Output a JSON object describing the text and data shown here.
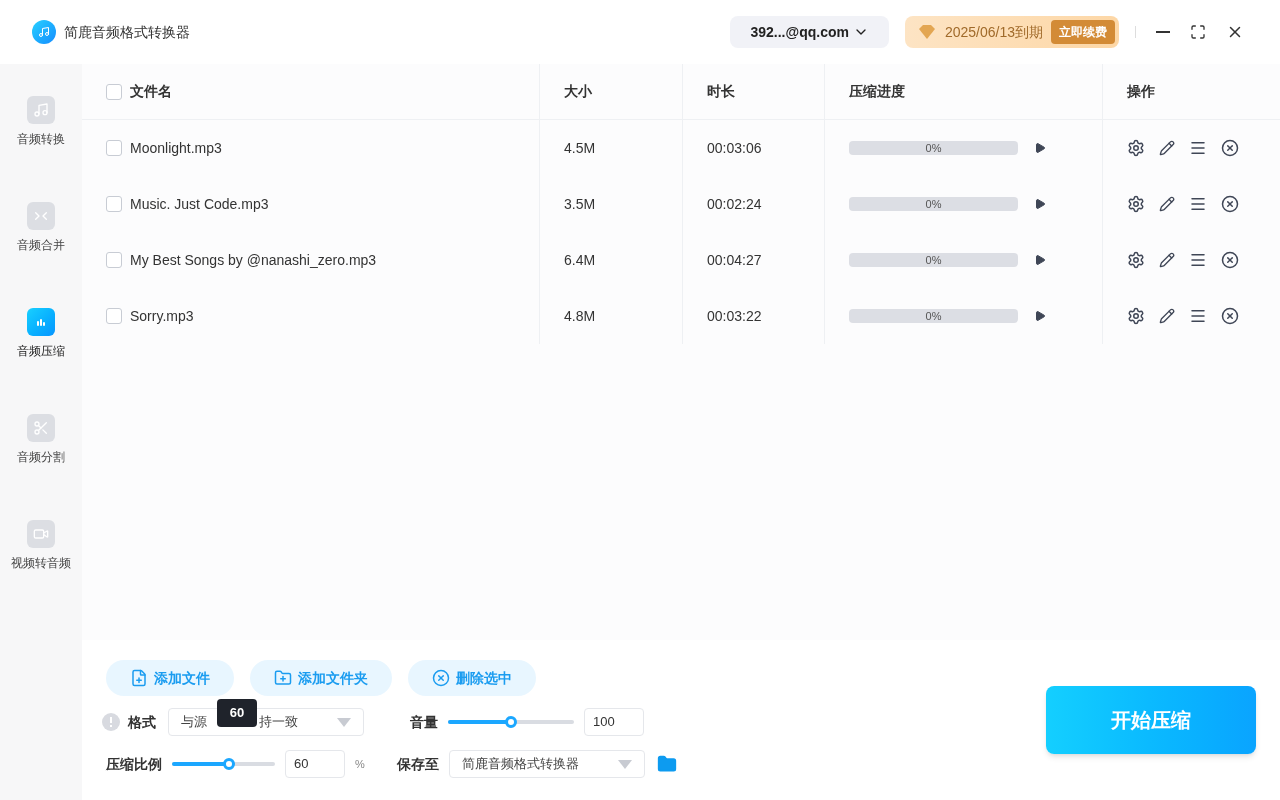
{
  "app": {
    "title": "简鹿音频格式转换器"
  },
  "account": {
    "label": "392...@qq.com"
  },
  "vip": {
    "expiry": "2025/06/13到期",
    "renew": "立即续费"
  },
  "sidebar": {
    "items": [
      {
        "label": "音频转换",
        "selected": false
      },
      {
        "label": "音频合并",
        "selected": false
      },
      {
        "label": "音频压缩",
        "selected": true
      },
      {
        "label": "音频分割",
        "selected": false
      },
      {
        "label": "视频转音频",
        "selected": false
      }
    ]
  },
  "table": {
    "columns": [
      "文件名",
      "大小",
      "时长",
      "压缩进度",
      "操作"
    ],
    "all_checked": false,
    "rows": [
      {
        "name": "Moonlight.mp3",
        "size": "4.5M",
        "duration": "00:03:06",
        "progress": "0%",
        "level": 0,
        "checked": false
      },
      {
        "name": "Music. Just Code.mp3",
        "size": "3.5M",
        "duration": "00:02:24",
        "progress": "0%",
        "level": 0,
        "checked": false
      },
      {
        "name": "My Best Songs by @nanashi_zero.mp3",
        "size": "6.4M",
        "duration": "00:04:27",
        "progress": "0%",
        "level": 0,
        "checked": false
      },
      {
        "name": "Sorry.mp3",
        "size": "4.8M",
        "duration": "00:03:22",
        "progress": "0%",
        "level": 0,
        "checked": false
      }
    ]
  },
  "actions": [
    {
      "label": "添加文件"
    },
    {
      "label": "添加文件夹"
    },
    {
      "label": "删除选中"
    }
  ],
  "format": {
    "label": "格式",
    "value_parts": [
      "与源",
      "持一致"
    ]
  },
  "volume": {
    "label": "音量",
    "level": 0.5,
    "value": "100"
  },
  "ratio": {
    "label": "压缩比例",
    "level": 0.55,
    "tooltip": "60",
    "value": "60",
    "unit": "%"
  },
  "save": {
    "label": "保存至",
    "value": "简鹿音频格式转换器"
  },
  "start": {
    "label": "开始压缩"
  }
}
